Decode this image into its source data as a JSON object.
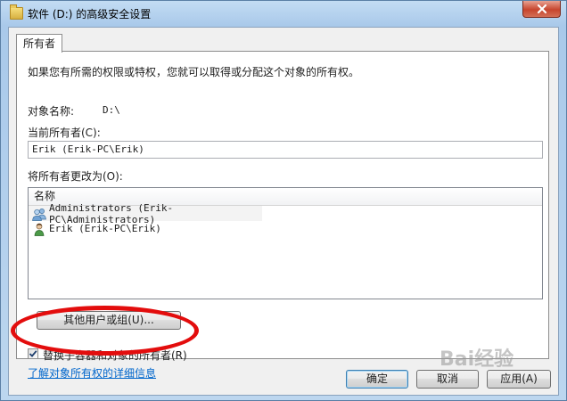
{
  "window": {
    "title": "软件 (D:) 的高级安全设置"
  },
  "tab": {
    "label": "所有者"
  },
  "panel": {
    "description": "如果您有所需的权限或特权，您就可以取得或分配这个对象的所有权。",
    "object_name_label": "对象名称:",
    "object_name_value": "D:\\",
    "current_owner_label": "当前所有者(C):",
    "current_owner_value": "Erik (Erik-PC\\Erik)",
    "change_owner_label": "将所有者更改为(O):",
    "list_header": "名称",
    "owners": [
      {
        "name": "Administrators (Erik-PC\\Administrators)",
        "icon": "users-group-icon"
      },
      {
        "name": "Erik (Erik-PC\\Erik)",
        "icon": "user-icon"
      }
    ],
    "other_users_button": "其他用户或组(U)...",
    "replace_owner_checkbox": {
      "label": "替换子容器和对象的所有者(R)",
      "checked": true
    },
    "learn_more_link": "了解对象所有权的详细信息"
  },
  "buttons": {
    "ok": "确定",
    "cancel": "取消",
    "apply": "应用(A)"
  },
  "watermark": {
    "text": "Bai经验"
  },
  "colors": {
    "annotation_ellipse": "#e30d0d",
    "link": "#0066cc",
    "close_button": "#c7452e"
  }
}
